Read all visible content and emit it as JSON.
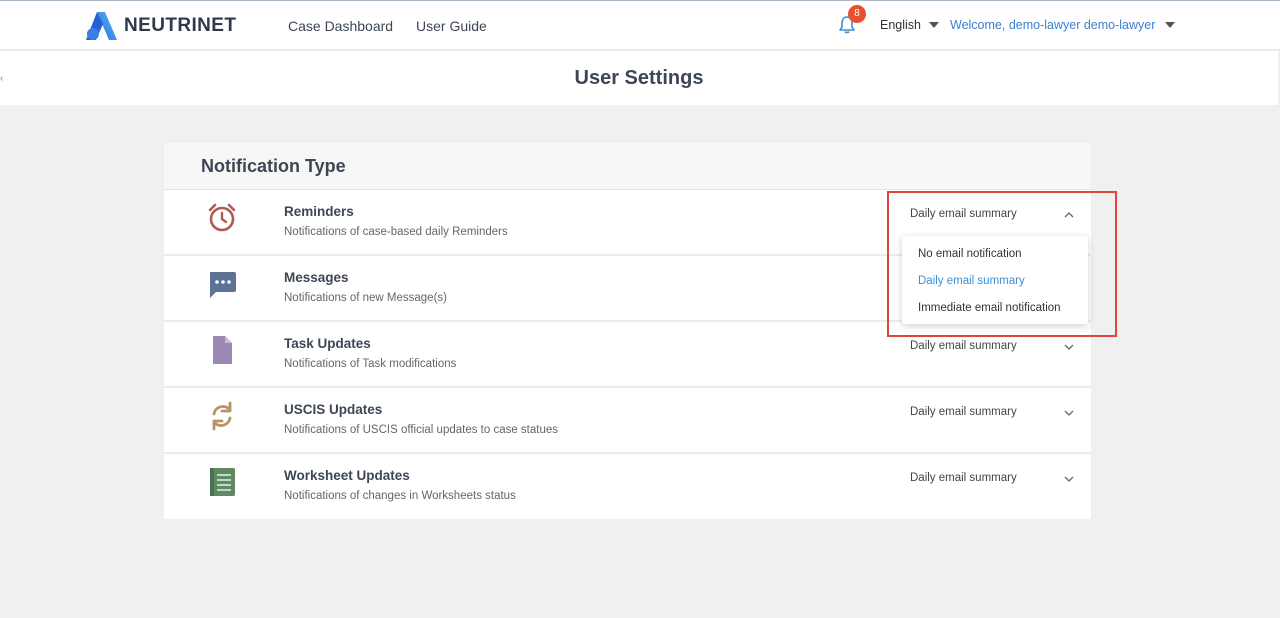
{
  "header": {
    "brand": "NEUTRINET",
    "nav": [
      {
        "label": "Case Dashboard"
      },
      {
        "label": "User Guide"
      }
    ],
    "notification_count": "8",
    "language": "English",
    "welcome": "Welcome, demo-lawyer demo-lawyer"
  },
  "page": {
    "title": "User Settings"
  },
  "notifications": {
    "section_title": "Notification Type",
    "rows": [
      {
        "title": "Reminders",
        "desc": "Notifications of case-based daily Reminders",
        "value": "Daily email summary",
        "icon": "alarm-clock-icon",
        "expanded": true
      },
      {
        "title": "Messages",
        "desc": "Notifications of new Message(s)",
        "value": "Daily email summary",
        "icon": "chat-bubble-icon"
      },
      {
        "title": "Task Updates",
        "desc": "Notifications of Task modifications",
        "value": "Daily email summary",
        "icon": "document-icon"
      },
      {
        "title": "USCIS Updates",
        "desc": "Notifications of USCIS official updates to case statues",
        "value": "Daily email summary",
        "icon": "sync-icon"
      },
      {
        "title": "Worksheet Updates",
        "desc": "Notifications of changes in Worksheets status",
        "value": "Daily email summary",
        "icon": "worksheet-icon"
      }
    ],
    "dropdown_options": [
      {
        "label": "No email notification"
      },
      {
        "label": "Daily email summary",
        "selected": true
      },
      {
        "label": "Immediate email notification"
      }
    ]
  },
  "colors": {
    "accent": "#3b8fd4",
    "badge": "#e8502f",
    "highlight": "#e0453d"
  }
}
